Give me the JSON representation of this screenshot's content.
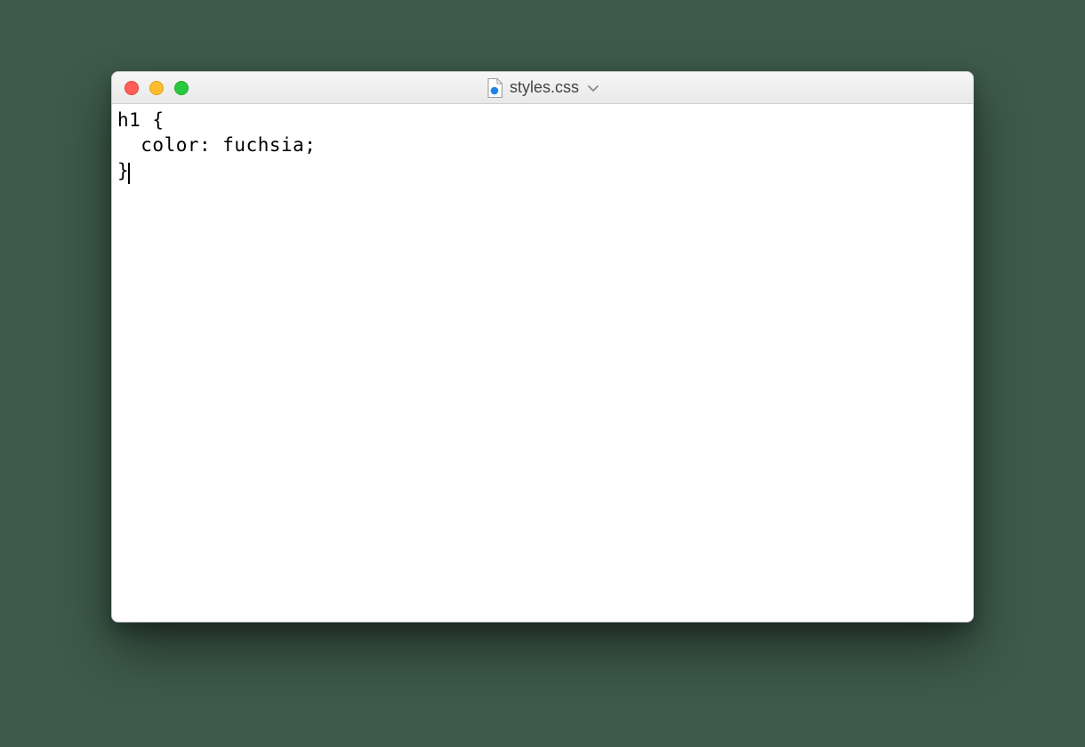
{
  "window": {
    "filename": "styles.css",
    "file_icon_name": "css-file-icon"
  },
  "editor": {
    "lines": [
      "h1 {",
      "  color: fuchsia;",
      "}"
    ]
  }
}
